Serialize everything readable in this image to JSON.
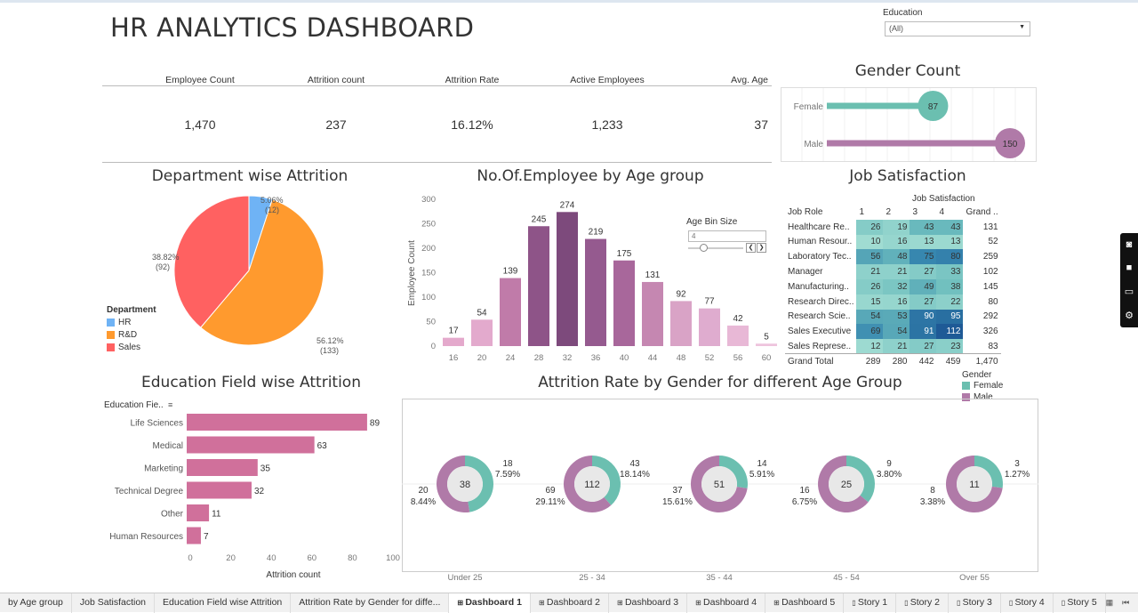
{
  "header": {
    "title": "HR ANALYTICS DASHBOARD"
  },
  "filter": {
    "label": "Education",
    "value": "(All)"
  },
  "kpis": [
    {
      "label": "Employee Count",
      "value": "1,470"
    },
    {
      "label": "Attrition count",
      "value": "237"
    },
    {
      "label": "Attrition Rate",
      "value": "16.12%"
    },
    {
      "label": "Active Employees",
      "value": "1,233"
    },
    {
      "label": "Avg. Age",
      "value": "37"
    }
  ],
  "titles": {
    "gender_count": "Gender Count",
    "dept": "Department wise Attrition",
    "age_group": "No.Of.Employee by Age group",
    "job_sat": "Job Satisfaction",
    "edu_field": "Education Field wise Attrition",
    "gender_age": "Attrition Rate by Gender for different Age Group"
  },
  "colors": {
    "teal": "#6bbfb0",
    "mauve": "#b07aa8",
    "hr": "#6fb3f5",
    "rd": "#ff9a2e",
    "sales": "#ff6161",
    "edu_bar": "#d0709b"
  },
  "chart_data": [
    {
      "type": "bar",
      "id": "gender_count",
      "categories": [
        "Female",
        "Male"
      ],
      "values": [
        87,
        150
      ]
    },
    {
      "type": "pie",
      "id": "department",
      "legend_title": "Department",
      "categories": [
        "HR",
        "R&D",
        "Sales"
      ],
      "values": [
        12,
        133,
        92
      ],
      "labels": [
        "5.06%",
        "56.12%",
        "38.82%"
      ],
      "counts": [
        "(12)",
        "(133)",
        "(92)"
      ]
    },
    {
      "type": "bar",
      "id": "age_group",
      "ylabel": "Employee Count",
      "control_label": "Age Bin Size",
      "control_value": "4",
      "categories": [
        "16",
        "20",
        "24",
        "28",
        "32",
        "36",
        "40",
        "44",
        "48",
        "52",
        "56",
        "60"
      ],
      "values": [
        17,
        54,
        139,
        245,
        274,
        219,
        175,
        131,
        92,
        77,
        42,
        5
      ],
      "yticks": [
        0,
        50,
        100,
        150,
        200,
        250,
        300
      ],
      "ylim": [
        0,
        300
      ]
    },
    {
      "type": "table",
      "id": "job_satisfaction",
      "row_header": "Job Role",
      "col_group": "Job Satisfaction",
      "columns": [
        "1",
        "2",
        "3",
        "4",
        "Grand .."
      ],
      "rows": [
        {
          "role": "Healthcare Re..",
          "v": [
            26,
            19,
            43,
            43
          ],
          "total": "131"
        },
        {
          "role": "Human Resour..",
          "v": [
            10,
            16,
            13,
            13
          ],
          "total": "52"
        },
        {
          "role": "Laboratory Tec..",
          "v": [
            56,
            48,
            75,
            80
          ],
          "total": "259"
        },
        {
          "role": "Manager",
          "v": [
            21,
            21,
            27,
            33
          ],
          "total": "102"
        },
        {
          "role": "Manufacturing..",
          "v": [
            26,
            32,
            49,
            38
          ],
          "total": "145"
        },
        {
          "role": "Research Direc..",
          "v": [
            15,
            16,
            27,
            22
          ],
          "total": "80"
        },
        {
          "role": "Research Scie..",
          "v": [
            54,
            53,
            90,
            95
          ],
          "total": "292"
        },
        {
          "role": "Sales Executive",
          "v": [
            69,
            54,
            91,
            112
          ],
          "total": "326"
        },
        {
          "role": "Sales Represe..",
          "v": [
            12,
            21,
            27,
            23
          ],
          "total": "83"
        }
      ],
      "grand_total": {
        "label": "Grand Total",
        "v": [
          "289",
          "280",
          "442",
          "459"
        ],
        "total": "1,470"
      }
    },
    {
      "type": "bar",
      "id": "education_field",
      "header": "Education Fie..",
      "xlabel": "Attrition count",
      "categories": [
        "Life Sciences",
        "Medical",
        "Marketing",
        "Technical Degree",
        "Other",
        "Human Resources"
      ],
      "values": [
        89,
        63,
        35,
        32,
        11,
        7
      ],
      "xticks": [
        0,
        20,
        40,
        60,
        80,
        100
      ],
      "xlim": [
        0,
        100
      ]
    },
    {
      "type": "pie",
      "id": "gender_age",
      "legend_title": "Gender",
      "legend": [
        "Female",
        "Male"
      ],
      "groups": [
        {
          "label": "Under 25",
          "total": 38,
          "female": 18,
          "female_pct": "7.59%",
          "male": 20,
          "male_pct": "8.44%"
        },
        {
          "label": "25 - 34",
          "total": 112,
          "female": 43,
          "female_pct": "18.14%",
          "male": 69,
          "male_pct": "29.11%"
        },
        {
          "label": "35 - 44",
          "total": 51,
          "female": 14,
          "female_pct": "5.91%",
          "male": 37,
          "male_pct": "15.61%"
        },
        {
          "label": "45 - 54",
          "total": 25,
          "female": 9,
          "female_pct": "3.80%",
          "male": 16,
          "male_pct": "6.75%"
        },
        {
          "label": "Over 55",
          "total": 11,
          "female": 3,
          "female_pct": "1.27%",
          "male": 8,
          "male_pct": "3.38%"
        }
      ]
    }
  ],
  "tabs": [
    "by Age group",
    "Job Satisfaction",
    "Education Field wise Attrition",
    "Attrition Rate by Gender for diffe...",
    "Dashboard 1",
    "Dashboard 2",
    "Dashboard 3",
    "Dashboard 4",
    "Dashboard 5",
    "Story 1",
    "Story 2",
    "Story 3",
    "Story 4",
    "Story 5"
  ],
  "active_tab": "Dashboard 1"
}
